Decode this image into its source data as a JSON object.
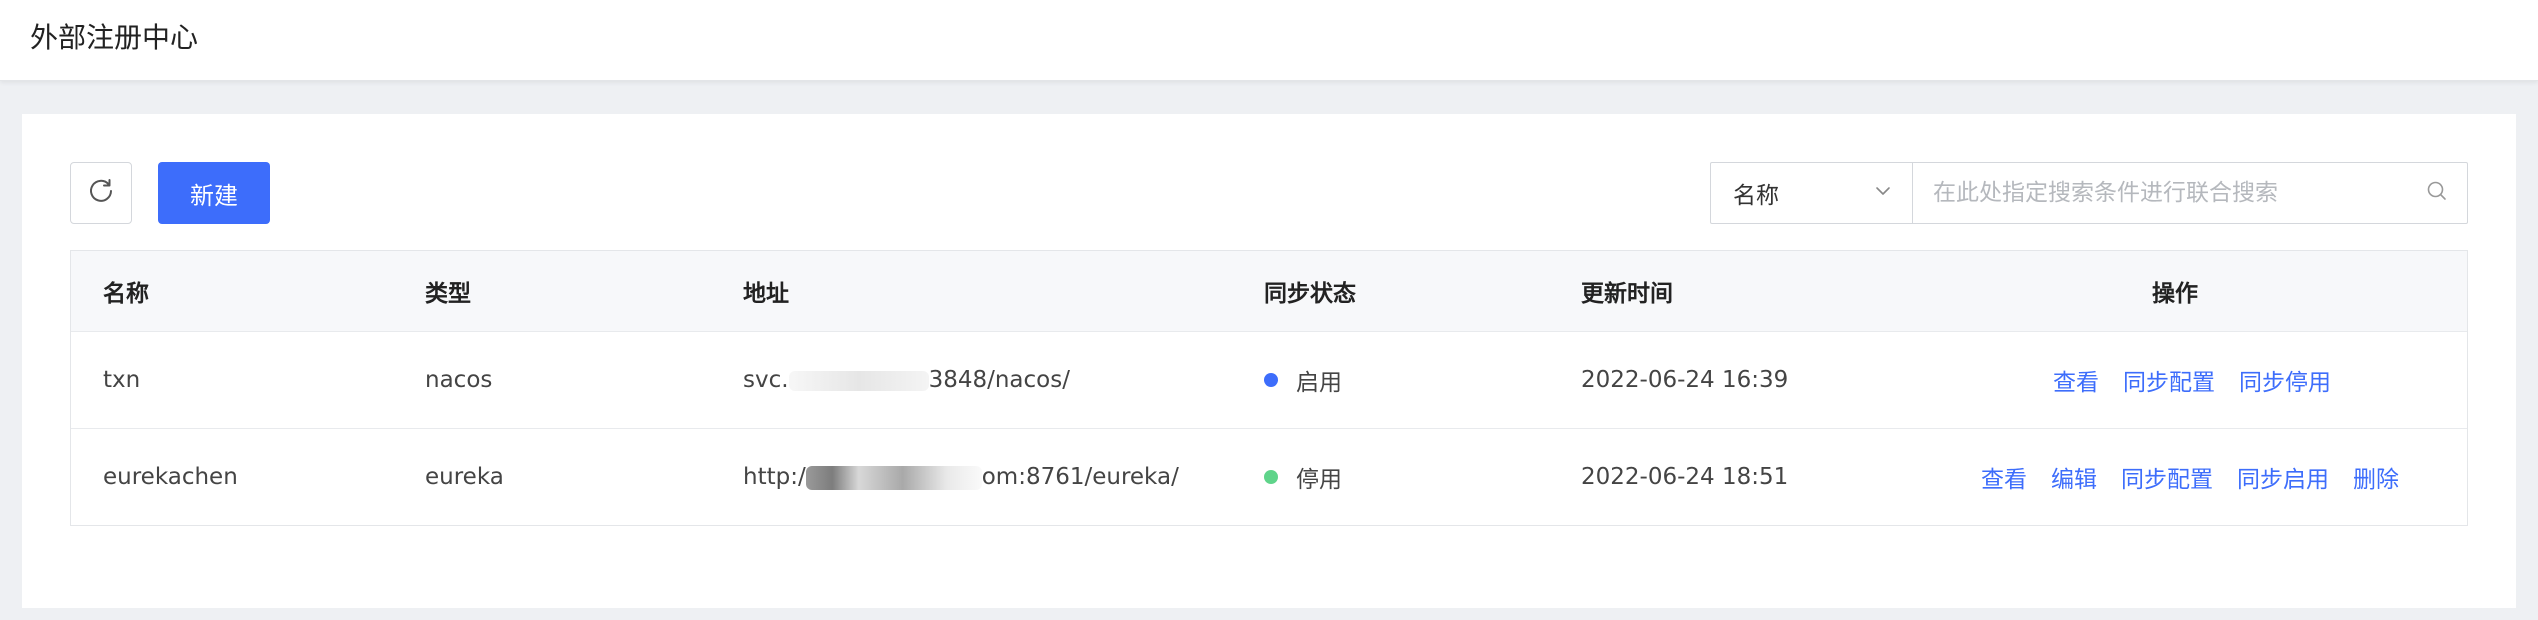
{
  "header": {
    "title": "外部注册中心"
  },
  "toolbar": {
    "new_label": "新建",
    "refresh_icon": "refresh-icon"
  },
  "search": {
    "select_value": "名称",
    "placeholder": "在此处指定搜索条件进行联合搜索"
  },
  "colors": {
    "accent": "#3d6dfb",
    "enabled": "#3d6dfb",
    "disabled": "#5fd48a"
  },
  "table": {
    "columns": [
      "名称",
      "类型",
      "地址",
      "同步状态",
      "更新时间",
      "操作"
    ],
    "rows": [
      {
        "name": "txn",
        "type": "nacos",
        "address_prefix": "svc.",
        "address_suffix": "3848/nacos/",
        "status": "启用",
        "updated": "2022-06-24 16:39",
        "actions": [
          "查看",
          "同步配置",
          "同步停用"
        ]
      },
      {
        "name": "eurekachen",
        "type": "eureka",
        "address_prefix": "http:/",
        "address_suffix": "om:8761/eureka/",
        "status": "停用",
        "updated": "2022-06-24 18:51",
        "actions": [
          "查看",
          "编辑",
          "同步配置",
          "同步启用",
          "删除"
        ]
      }
    ]
  }
}
